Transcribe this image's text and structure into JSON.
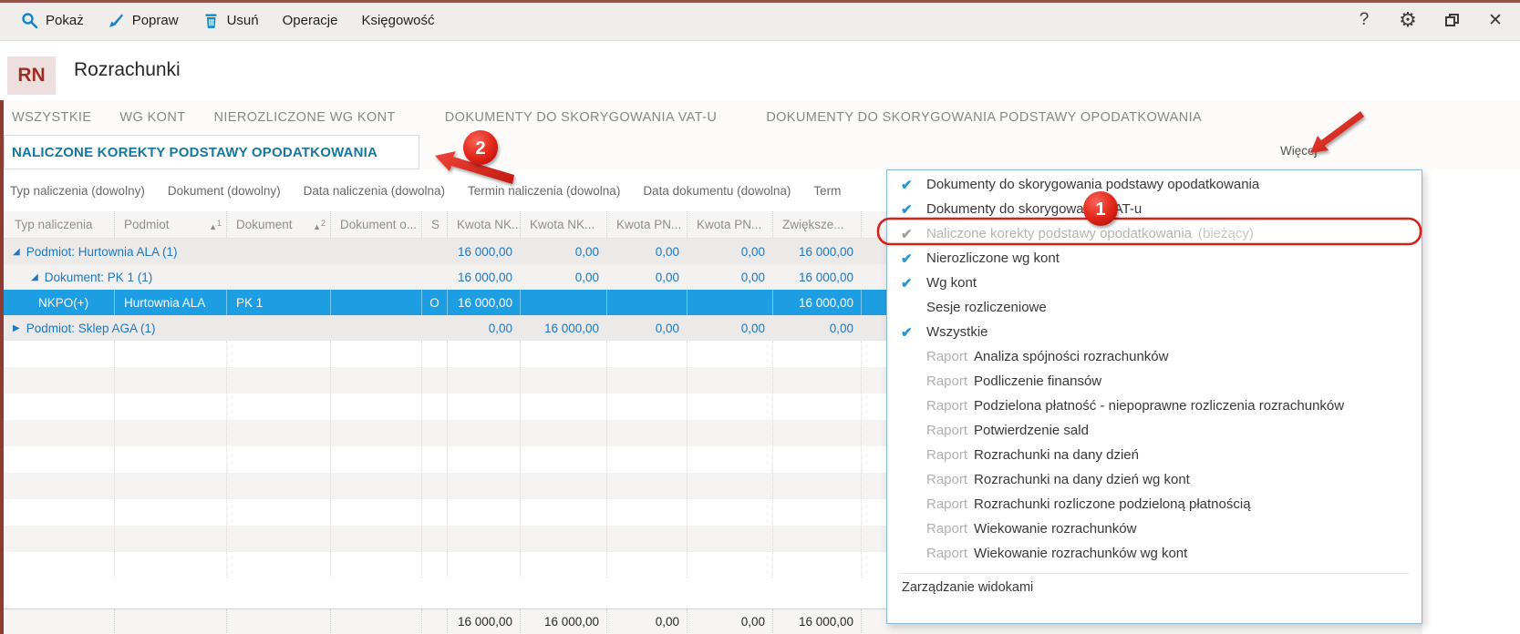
{
  "header": {
    "badge": "RN",
    "title": "Rozrachunki"
  },
  "toolbar": [
    {
      "label": "Pokaż",
      "icon": "search"
    },
    {
      "label": "Popraw",
      "icon": "brush"
    },
    {
      "label": "Usuń",
      "icon": "trash"
    },
    {
      "label": "Operacje",
      "icon": null
    },
    {
      "label": "Księgowość",
      "icon": null
    }
  ],
  "window_controls": [
    {
      "name": "help",
      "glyph": "?"
    },
    {
      "name": "settings",
      "glyph": "⚙"
    },
    {
      "name": "restore",
      "glyph": ""
    },
    {
      "name": "close",
      "glyph": "✕"
    }
  ],
  "tabs": {
    "row1": [
      "WSZYSTKIE",
      "WG KONT",
      "NIEROZLICZONE WG KONT",
      "DOKUMENTY DO SKORYGOWANIA VAT-U",
      "DOKUMENTY DO SKORYGOWANIA PODSTAWY OPODATKOWANIA"
    ],
    "active": "NALICZONE KOREKTY PODSTAWY OPODATKOWANIA",
    "more": "Więcej"
  },
  "filters": [
    "Typ naliczenia (dowolny)",
    "Dokument (dowolny)",
    "Data naliczenia (dowolna)",
    "Termin naliczenia (dowolna)",
    "Data dokumentu (dowolna)",
    "Term"
  ],
  "grid": {
    "columns": [
      {
        "label": "Typ naliczenia"
      },
      {
        "label": "Podmiot",
        "sort": "1"
      },
      {
        "label": "Dokument",
        "sort": "2"
      },
      {
        "label": "Dokument o..."
      },
      {
        "label": "S"
      },
      {
        "label": "Kwota NK..."
      },
      {
        "label": "Kwota NK..."
      },
      {
        "label": "Kwota PN..."
      },
      {
        "label": "Kwota PN..."
      },
      {
        "label": "Zwiększe..."
      }
    ],
    "rows": [
      {
        "kind": "group",
        "level": 1,
        "expanded": true,
        "label": "Podmiot: Hurtownia ALA (1)",
        "amounts": [
          "16 000,00",
          "0,00",
          "0,00",
          "0,00",
          "16 000,00"
        ]
      },
      {
        "kind": "group",
        "level": 2,
        "expanded": true,
        "label": "Dokument: PK 1 (1)",
        "amounts": [
          "16 000,00",
          "0,00",
          "0,00",
          "0,00",
          "16 000,00"
        ]
      },
      {
        "kind": "data",
        "selected": true,
        "cells": [
          "NKPO(+)",
          "Hurtownia ALA",
          "PK 1",
          "",
          "O",
          "16 000,00",
          "",
          "",
          "",
          "16 000,00"
        ]
      },
      {
        "kind": "group",
        "level": 1,
        "expanded": false,
        "label": "Podmiot: Sklep AGA (1)",
        "amounts": [
          "0,00",
          "16 000,00",
          "0,00",
          "0,00",
          "0,00"
        ]
      }
    ],
    "summary": [
      "16 000,00",
      "16 000,00",
      "0,00",
      "0,00",
      "16 000,00"
    ]
  },
  "menu": {
    "items": [
      {
        "label": "Dokumenty do skorygowania podstawy opodatkowania",
        "checked": true
      },
      {
        "label": "Dokumenty do skorygowania VAT-u",
        "checked": true
      },
      {
        "label": "Naliczone korekty podstawy opodatkowania",
        "suffix": "(bieżący)",
        "checked": true,
        "current": true
      },
      {
        "label": "Nierozliczone wg kont",
        "checked": true
      },
      {
        "label": "Wg kont",
        "checked": true
      },
      {
        "label": "Sesje rozliczeniowe",
        "checked": false
      },
      {
        "label": "Wszystkie",
        "checked": true
      },
      {
        "prefix": "Raport",
        "label": "Analiza spójności rozrachunków",
        "checked": false
      },
      {
        "prefix": "Raport",
        "label": "Podliczenie finansów",
        "checked": false
      },
      {
        "prefix": "Raport",
        "label": "Podzielona płatność - niepoprawne rozliczenia rozrachunków",
        "checked": false
      },
      {
        "prefix": "Raport",
        "label": "Potwierdzenie sald",
        "checked": false
      },
      {
        "prefix": "Raport",
        "label": "Rozrachunki na dany dzień",
        "checked": false
      },
      {
        "prefix": "Raport",
        "label": "Rozrachunki na dany dzień wg kont",
        "checked": false
      },
      {
        "prefix": "Raport",
        "label": "Rozrachunki rozliczone podzieloną płatnością",
        "checked": false
      },
      {
        "prefix": "Raport",
        "label": "Wiekowanie rozrachunków",
        "checked": false
      },
      {
        "prefix": "Raport",
        "label": "Wiekowanie rozrachunków wg kont",
        "checked": false
      }
    ],
    "footer": "Zarządzanie widokami"
  },
  "annotations": {
    "badge_1": "1",
    "badge_2": "2"
  },
  "icons": {
    "expanded": "◢",
    "collapsed": "▶",
    "check": "✔",
    "sort_asc": "▲"
  },
  "colors": {
    "selection_blue": "#1e9ee2",
    "group_link_blue": "#1e76c0",
    "active_tab_blue": "#15779e",
    "toolbar_icon_blue": "#1486c8",
    "check_blue": "#2196d9",
    "annotation_red": "#d6201a",
    "maroon_strip": "#8e3b34"
  }
}
